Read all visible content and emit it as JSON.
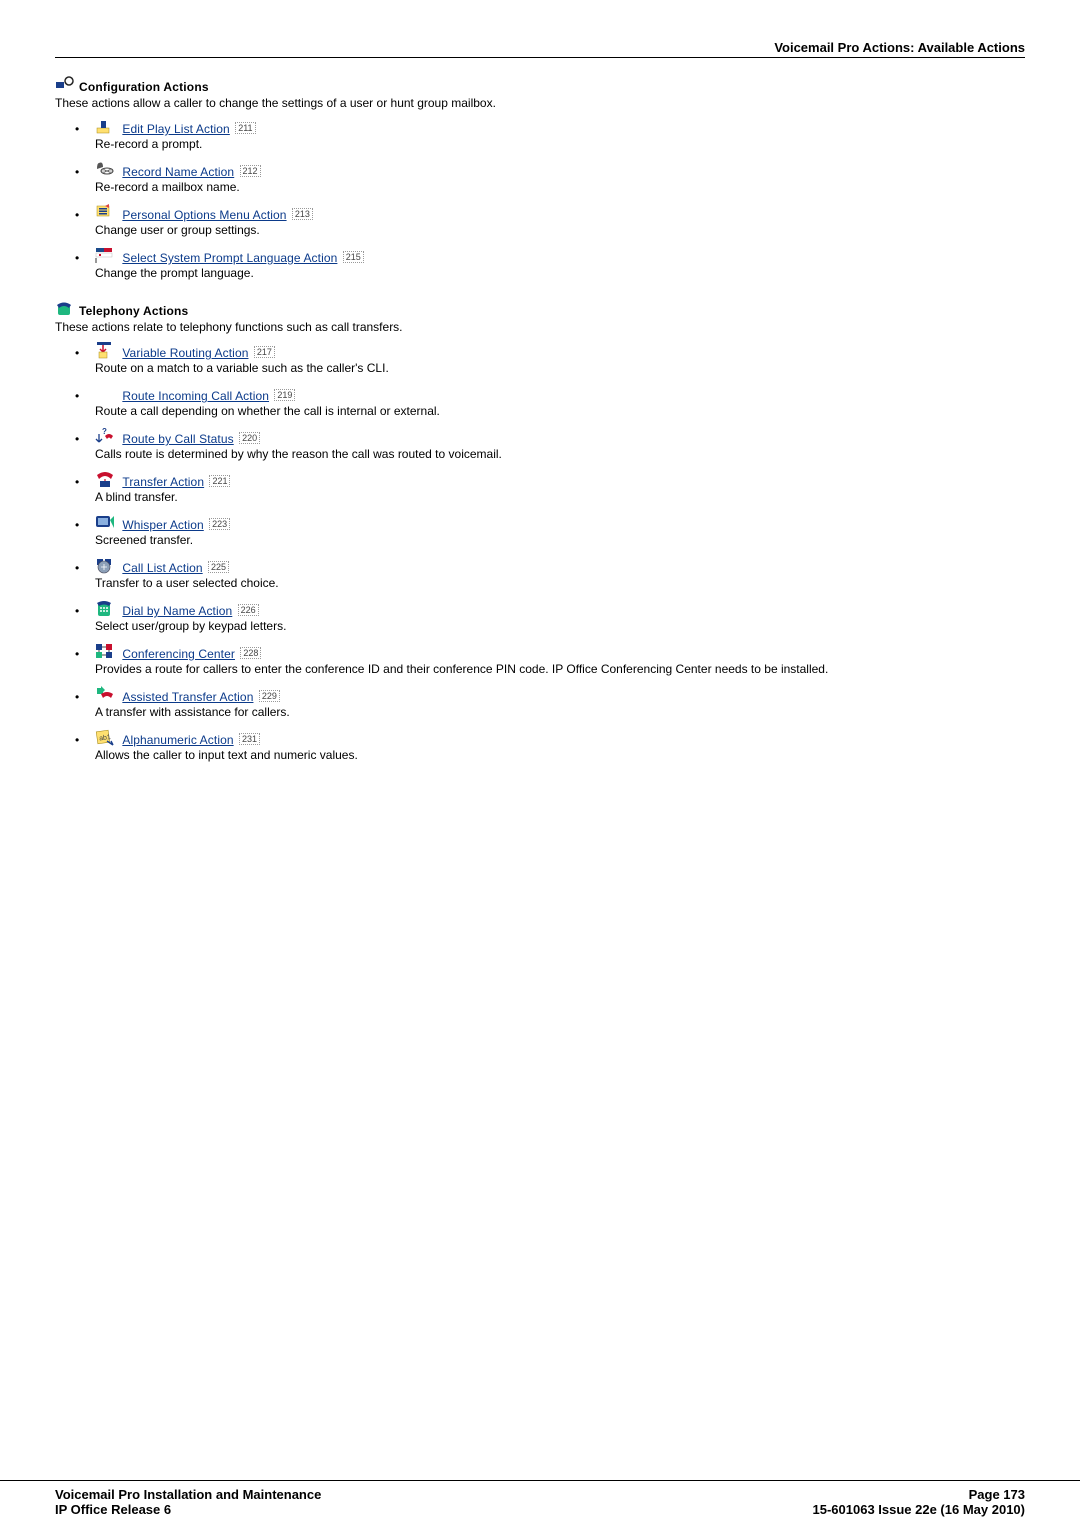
{
  "header": {
    "title": "Voicemail Pro Actions: Available Actions"
  },
  "config_actions": {
    "heading": "Configuration Actions",
    "intro": "These actions allow a caller to change the settings of a user or hunt group mailbox.",
    "items": [
      {
        "link": "Edit Play List Action",
        "page": "211",
        "desc": "Re-record a prompt.",
        "icon": "playlist-icon"
      },
      {
        "link": "Record Name Action",
        "page": "212",
        "desc": "Re-record a mailbox name.",
        "icon": "record-icon"
      },
      {
        "link": "Personal Options Menu Action",
        "page": "213",
        "desc": "Change user or group settings.",
        "icon": "menu-icon"
      },
      {
        "link": "Select System Prompt Language Action",
        "page": "215",
        "desc": "Change the prompt language.",
        "icon": "flag-icon"
      }
    ]
  },
  "telephony_actions": {
    "heading": "Telephony Actions",
    "intro": "These actions relate to telephony functions such as call transfers.",
    "items": [
      {
        "link": "Variable Routing Action",
        "page": "217",
        "desc": "Route on a match to a variable such as the caller's CLI.",
        "icon": "routing-icon"
      },
      {
        "link": "Route Incoming Call Action",
        "page": "219",
        "desc": "Route a call depending on whether the call is internal or external.",
        "icon": "blank-icon"
      },
      {
        "link": "Route by Call Status",
        "page": "220",
        "desc": "Calls route is determined by why the reason the call was routed to voicemail.",
        "icon": "status-icon"
      },
      {
        "link": "Transfer Action",
        "page": "221",
        "desc": "A blind transfer.",
        "icon": "transfer-icon"
      },
      {
        "link": "Whisper Action",
        "page": "223",
        "desc": "Screened transfer.",
        "icon": "whisper-icon"
      },
      {
        "link": "Call List Action",
        "page": "225",
        "desc": "Transfer to a user selected choice.",
        "icon": "call-list-icon"
      },
      {
        "link": "Dial by Name Action",
        "page": "226",
        "desc": "Select user/group by keypad letters.",
        "icon": "dial-icon"
      },
      {
        "link": "Conferencing Center",
        "page": "228",
        "desc": "Provides a route for callers to enter the conference ID and their conference PIN code. IP Office Conferencing Center needs to be installed.",
        "icon": "conference-icon"
      },
      {
        "link": "Assisted Transfer Action",
        "page": "229",
        "desc": "A transfer with assistance for callers.",
        "icon": "assisted-icon"
      },
      {
        "link": "Alphanumeric Action",
        "page": "231",
        "desc": "Allows the caller to input text and numeric values.",
        "icon": "alpha-icon"
      }
    ]
  },
  "footer": {
    "left1": "Voicemail Pro Installation and Maintenance",
    "left2": "IP Office Release 6",
    "right1": "Page 173",
    "right2": "15-601063 Issue 22e (16 May 2010)"
  }
}
